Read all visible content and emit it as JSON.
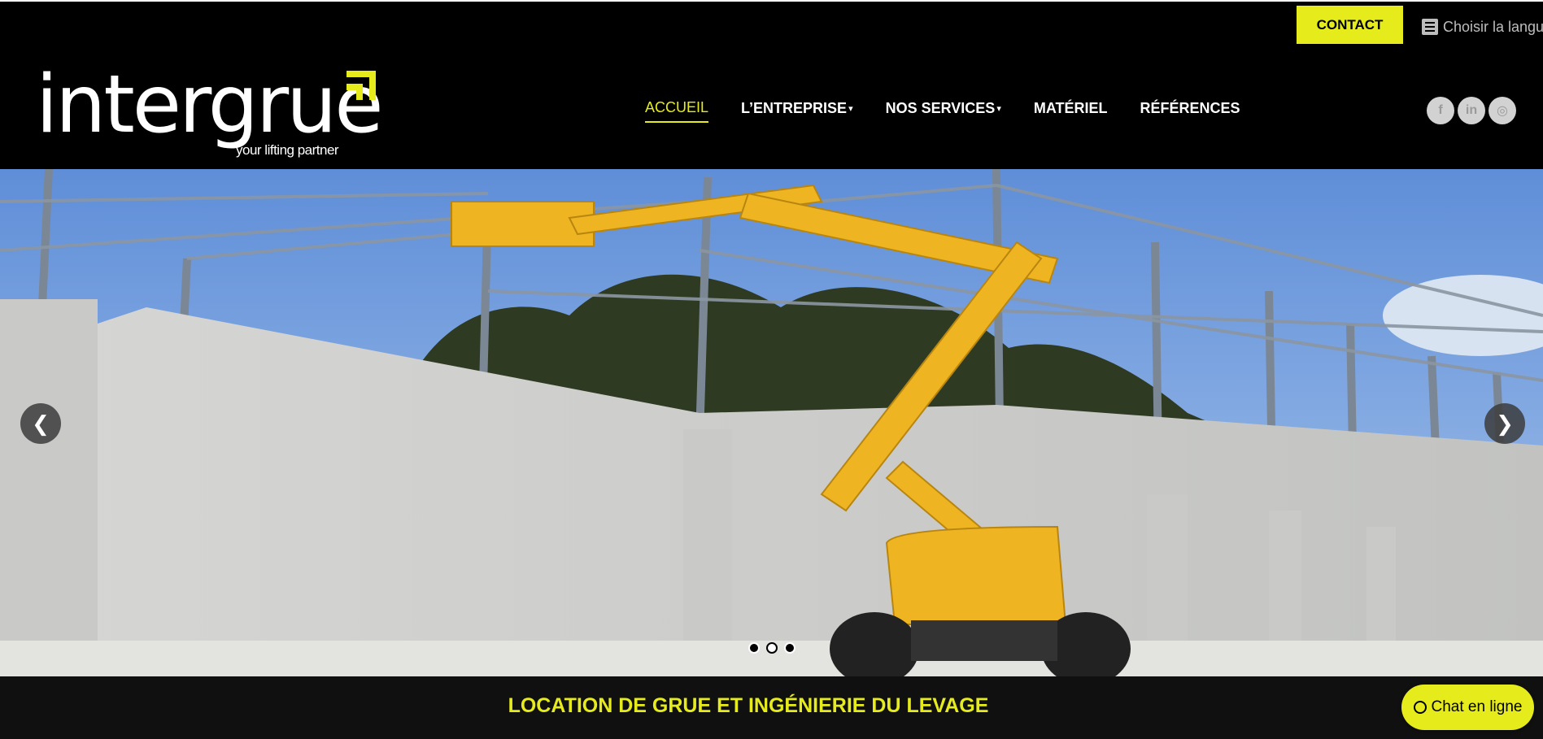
{
  "header": {
    "contact_label": "CONTACT",
    "language_label": "Choisir la langue",
    "language_icon": "list-icon",
    "logo": {
      "word": "intergrue",
      "tagline": "your lifting partner"
    },
    "nav": [
      {
        "label": "ACCUEIL",
        "active": true
      },
      {
        "label": "L’ENTREPRISE",
        "caret": "▾"
      },
      {
        "label": "NOS SERVICES",
        "caret": "▾"
      },
      {
        "label": "MATÉRIEL"
      },
      {
        "label": "RÉFÉRENCES"
      }
    ],
    "social": [
      {
        "icon": "facebook-icon",
        "glyph": "f"
      },
      {
        "icon": "linkedin-icon",
        "glyph": "in"
      },
      {
        "icon": "instagram-icon",
        "glyph": "◎"
      }
    ]
  },
  "hero": {
    "prev_glyph": "❮",
    "next_glyph": "❯",
    "slides_count": 3,
    "active_slide": 2
  },
  "band": {
    "title": "LOCATION DE GRUE ET INGÉNIERIE DU LEVAGE"
  },
  "chat": {
    "label": "Chat en ligne",
    "icon": "whatsapp-icon"
  },
  "colors": {
    "accent": "#e6ec1c",
    "background": "#000000",
    "band": "#101010"
  }
}
